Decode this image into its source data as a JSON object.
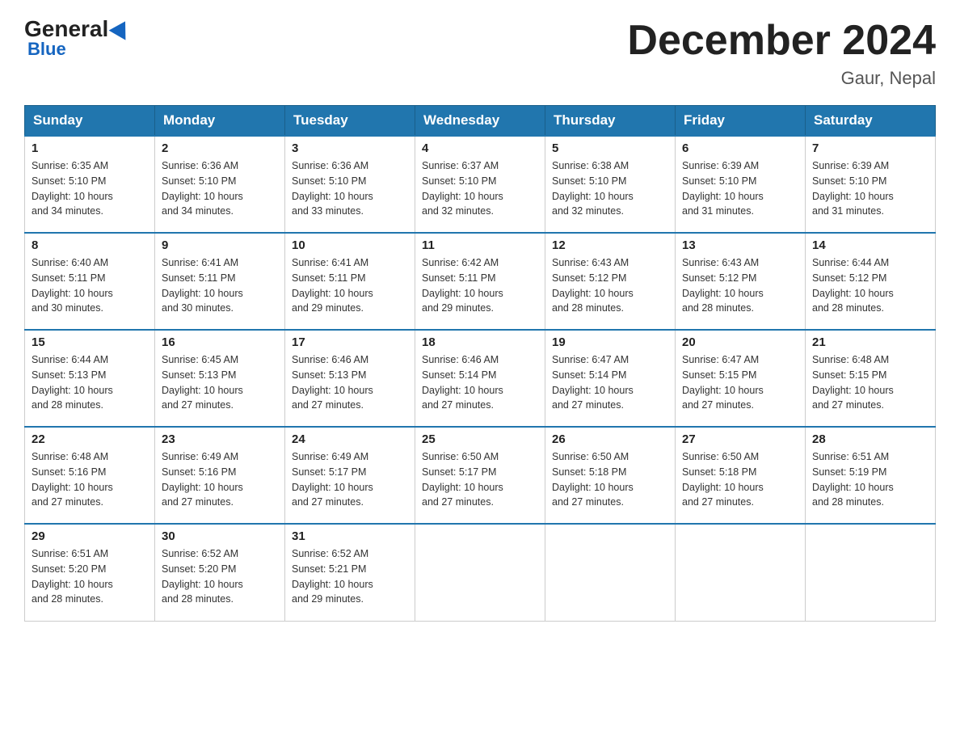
{
  "header": {
    "logo_general": "General",
    "logo_blue": "Blue",
    "month_title": "December 2024",
    "location": "Gaur, Nepal"
  },
  "days_of_week": [
    "Sunday",
    "Monday",
    "Tuesday",
    "Wednesday",
    "Thursday",
    "Friday",
    "Saturday"
  ],
  "weeks": [
    [
      {
        "day": "1",
        "sunrise": "6:35 AM",
        "sunset": "5:10 PM",
        "daylight": "10 hours and 34 minutes."
      },
      {
        "day": "2",
        "sunrise": "6:36 AM",
        "sunset": "5:10 PM",
        "daylight": "10 hours and 34 minutes."
      },
      {
        "day": "3",
        "sunrise": "6:36 AM",
        "sunset": "5:10 PM",
        "daylight": "10 hours and 33 minutes."
      },
      {
        "day": "4",
        "sunrise": "6:37 AM",
        "sunset": "5:10 PM",
        "daylight": "10 hours and 32 minutes."
      },
      {
        "day": "5",
        "sunrise": "6:38 AM",
        "sunset": "5:10 PM",
        "daylight": "10 hours and 32 minutes."
      },
      {
        "day": "6",
        "sunrise": "6:39 AM",
        "sunset": "5:10 PM",
        "daylight": "10 hours and 31 minutes."
      },
      {
        "day": "7",
        "sunrise": "6:39 AM",
        "sunset": "5:10 PM",
        "daylight": "10 hours and 31 minutes."
      }
    ],
    [
      {
        "day": "8",
        "sunrise": "6:40 AM",
        "sunset": "5:11 PM",
        "daylight": "10 hours and 30 minutes."
      },
      {
        "day": "9",
        "sunrise": "6:41 AM",
        "sunset": "5:11 PM",
        "daylight": "10 hours and 30 minutes."
      },
      {
        "day": "10",
        "sunrise": "6:41 AM",
        "sunset": "5:11 PM",
        "daylight": "10 hours and 29 minutes."
      },
      {
        "day": "11",
        "sunrise": "6:42 AM",
        "sunset": "5:11 PM",
        "daylight": "10 hours and 29 minutes."
      },
      {
        "day": "12",
        "sunrise": "6:43 AM",
        "sunset": "5:12 PM",
        "daylight": "10 hours and 28 minutes."
      },
      {
        "day": "13",
        "sunrise": "6:43 AM",
        "sunset": "5:12 PM",
        "daylight": "10 hours and 28 minutes."
      },
      {
        "day": "14",
        "sunrise": "6:44 AM",
        "sunset": "5:12 PM",
        "daylight": "10 hours and 28 minutes."
      }
    ],
    [
      {
        "day": "15",
        "sunrise": "6:44 AM",
        "sunset": "5:13 PM",
        "daylight": "10 hours and 28 minutes."
      },
      {
        "day": "16",
        "sunrise": "6:45 AM",
        "sunset": "5:13 PM",
        "daylight": "10 hours and 27 minutes."
      },
      {
        "day": "17",
        "sunrise": "6:46 AM",
        "sunset": "5:13 PM",
        "daylight": "10 hours and 27 minutes."
      },
      {
        "day": "18",
        "sunrise": "6:46 AM",
        "sunset": "5:14 PM",
        "daylight": "10 hours and 27 minutes."
      },
      {
        "day": "19",
        "sunrise": "6:47 AM",
        "sunset": "5:14 PM",
        "daylight": "10 hours and 27 minutes."
      },
      {
        "day": "20",
        "sunrise": "6:47 AM",
        "sunset": "5:15 PM",
        "daylight": "10 hours and 27 minutes."
      },
      {
        "day": "21",
        "sunrise": "6:48 AM",
        "sunset": "5:15 PM",
        "daylight": "10 hours and 27 minutes."
      }
    ],
    [
      {
        "day": "22",
        "sunrise": "6:48 AM",
        "sunset": "5:16 PM",
        "daylight": "10 hours and 27 minutes."
      },
      {
        "day": "23",
        "sunrise": "6:49 AM",
        "sunset": "5:16 PM",
        "daylight": "10 hours and 27 minutes."
      },
      {
        "day": "24",
        "sunrise": "6:49 AM",
        "sunset": "5:17 PM",
        "daylight": "10 hours and 27 minutes."
      },
      {
        "day": "25",
        "sunrise": "6:50 AM",
        "sunset": "5:17 PM",
        "daylight": "10 hours and 27 minutes."
      },
      {
        "day": "26",
        "sunrise": "6:50 AM",
        "sunset": "5:18 PM",
        "daylight": "10 hours and 27 minutes."
      },
      {
        "day": "27",
        "sunrise": "6:50 AM",
        "sunset": "5:18 PM",
        "daylight": "10 hours and 27 minutes."
      },
      {
        "day": "28",
        "sunrise": "6:51 AM",
        "sunset": "5:19 PM",
        "daylight": "10 hours and 28 minutes."
      }
    ],
    [
      {
        "day": "29",
        "sunrise": "6:51 AM",
        "sunset": "5:20 PM",
        "daylight": "10 hours and 28 minutes."
      },
      {
        "day": "30",
        "sunrise": "6:52 AM",
        "sunset": "5:20 PM",
        "daylight": "10 hours and 28 minutes."
      },
      {
        "day": "31",
        "sunrise": "6:52 AM",
        "sunset": "5:21 PM",
        "daylight": "10 hours and 29 minutes."
      },
      null,
      null,
      null,
      null
    ]
  ],
  "labels": {
    "sunrise": "Sunrise:",
    "sunset": "Sunset:",
    "daylight": "Daylight:"
  }
}
